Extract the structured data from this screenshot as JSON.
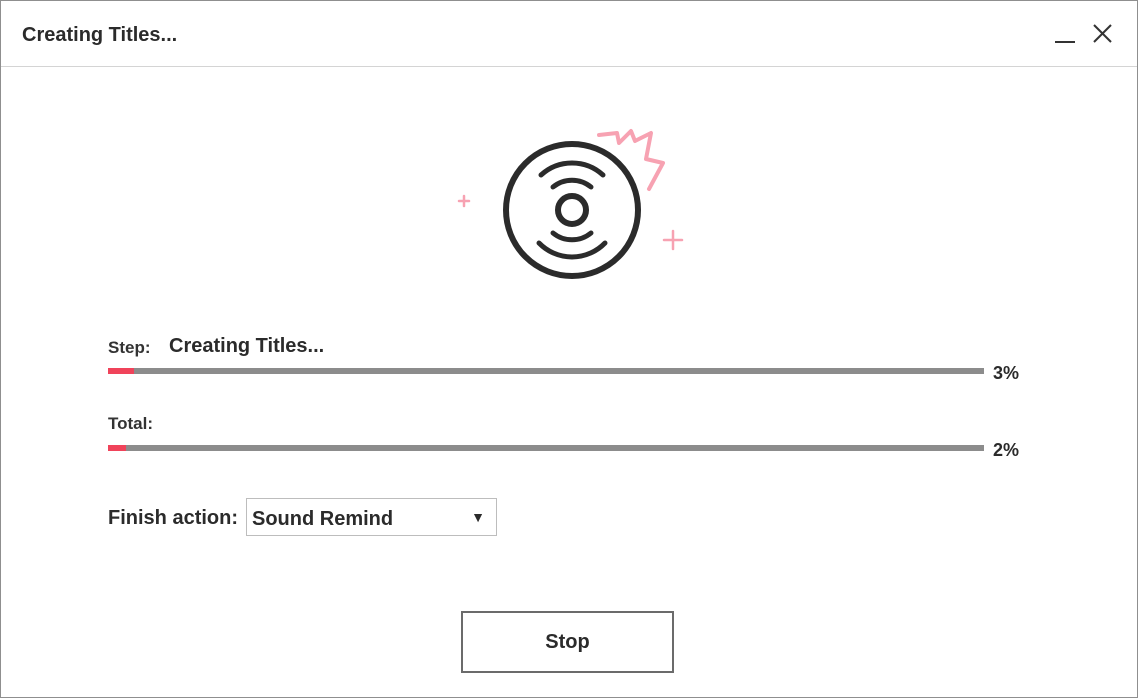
{
  "window": {
    "title": "Creating Titles...",
    "minimize_icon": "minimize-icon",
    "close_icon": "close-icon"
  },
  "illustration": {
    "icon": "disc-icon",
    "accent_color": "#f0435a",
    "sparkle_color": "#f7a2b2"
  },
  "progress": {
    "step_label": "Step:",
    "step_text": "Creating Titles...",
    "step_percent_text": "3%",
    "step_value": 0.03,
    "total_label": "Total:",
    "total_percent_text": "2%",
    "total_value": 0.02,
    "bar_color": "#8c8c8c",
    "fill_color": "#f0435a"
  },
  "finish": {
    "label": "Finish action:",
    "selected": "Sound Remind",
    "arrow_icon": "dropdown-arrow-icon"
  },
  "buttons": {
    "stop_label": "Stop"
  }
}
